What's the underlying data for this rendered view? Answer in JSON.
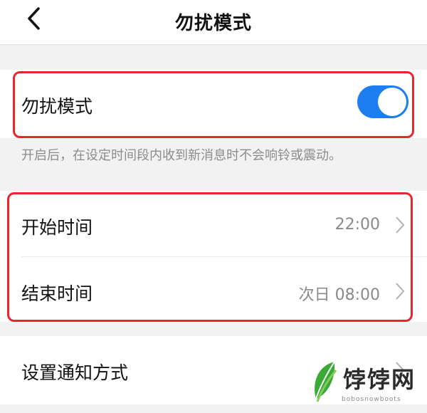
{
  "header": {
    "title": "勿扰模式"
  },
  "dnd": {
    "label": "勿扰模式",
    "enabled": true,
    "hint": "开启后，在设定时间段内收到新消息时不会响铃或震动。"
  },
  "schedule": {
    "start": {
      "label": "开始时间",
      "value": "22:00"
    },
    "end": {
      "label": "结束时间",
      "value": "次日 08:00"
    }
  },
  "notify": {
    "label": "设置通知方式"
  },
  "watermark": {
    "brand": "饽饽网",
    "sub": "bobosnowboots"
  },
  "colors": {
    "toggle_on": "#1c7ef0",
    "highlight_box": "#e8262d"
  }
}
